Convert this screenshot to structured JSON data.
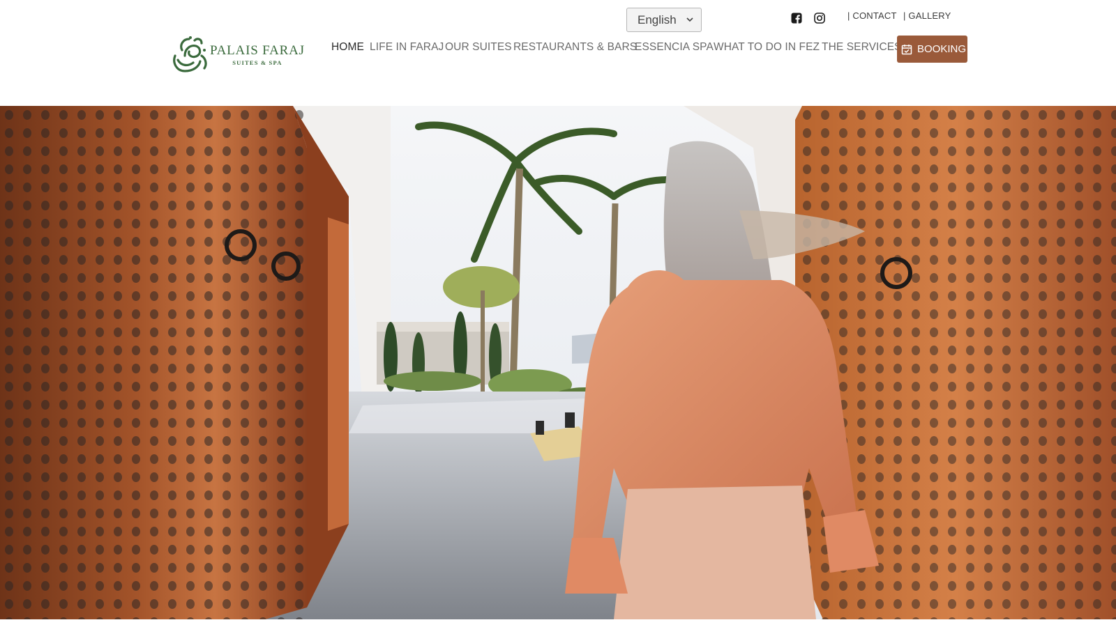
{
  "language_selector": {
    "value": "English",
    "icon": "chevron-down-icon"
  },
  "social": [
    {
      "name": "facebook",
      "icon": "facebook-icon"
    },
    {
      "name": "instagram",
      "icon": "instagram-icon"
    }
  ],
  "top_links": {
    "contact": "| CONTACT",
    "gallery": "| GALLERY"
  },
  "logo": {
    "name": "PALAIS FARAJ",
    "subtitle": "SUITES & SPA",
    "emblem": "Arabic calligraphy emblem"
  },
  "nav": {
    "items": [
      {
        "label": "HOME",
        "active": true
      },
      {
        "label": "LIFE IN FARAJ",
        "active": false
      },
      {
        "label": "OUR SUITES",
        "active": false
      },
      {
        "label": "RESTAURANTS & BARS",
        "active": false
      },
      {
        "label": "ESSENCIA SPA",
        "active": false
      },
      {
        "label": "WHAT TO DO IN FEZ",
        "active": false
      },
      {
        "label": "THE SERVICES",
        "active": false
      }
    ],
    "booking": {
      "label": "BOOKING",
      "icon": "calendar-check-icon"
    }
  },
  "colors": {
    "brand_green": "#3a6a3c",
    "booking_bg": "#9a5a3a",
    "nav_text": "#6a6a6a",
    "nav_active": "#2b2b2b"
  },
  "hero": {
    "type": "video",
    "scene": "woman walking through open carved wooden doors into palace garden"
  }
}
